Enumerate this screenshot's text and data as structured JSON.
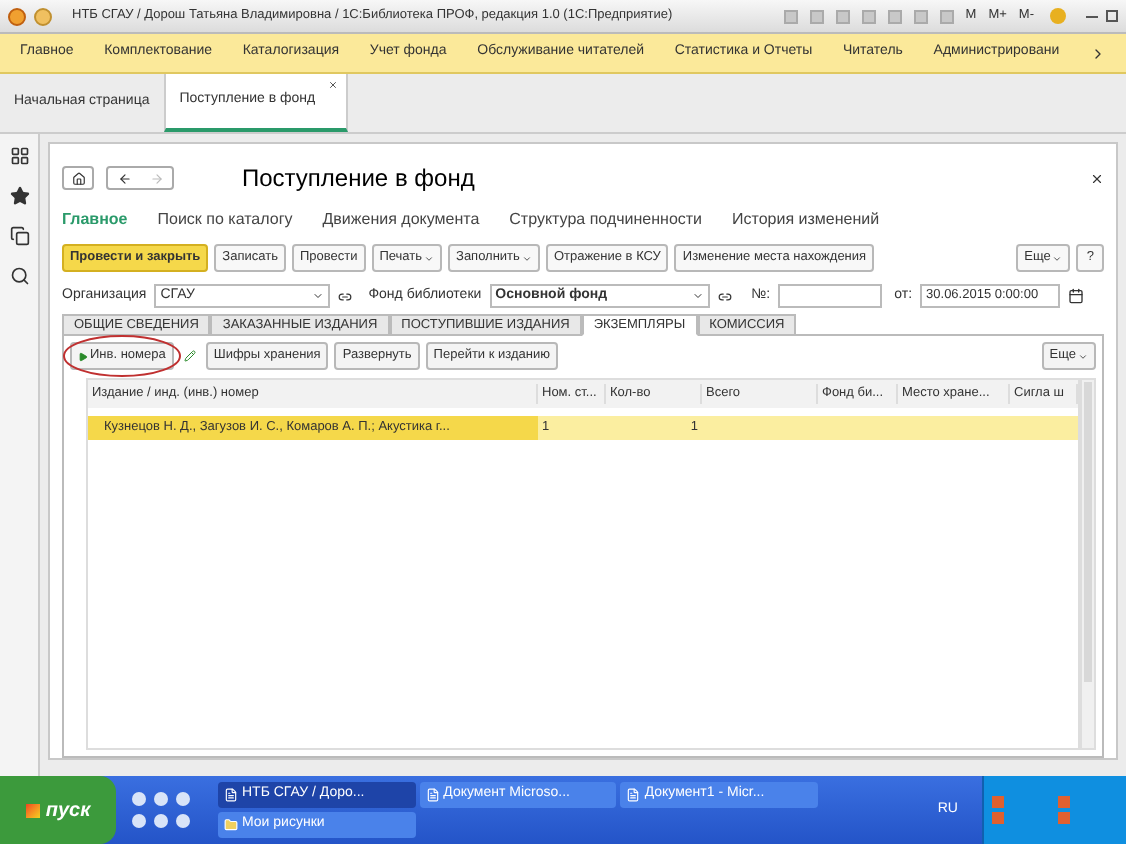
{
  "window": {
    "title": "НТБ СГАУ / Дорош Татьяна Владимировна / 1С:Библиотека ПРОФ, редакция 1.0  (1С:Предприятие)",
    "memory_buttons": [
      "M",
      "M+",
      "M-"
    ]
  },
  "menu": [
    "Главное",
    "Комплектование",
    "Каталогизация",
    "Учет фонда",
    "Обслуживание читателей",
    "Статистика и Отчеты",
    "Читатель",
    "Администрировани"
  ],
  "open_tabs": [
    {
      "label": "Начальная страница",
      "selected": false
    },
    {
      "label": "Поступление в фонд",
      "selected": true
    }
  ],
  "form": {
    "title": "Поступление в фонд",
    "nav": [
      {
        "label": "Главное",
        "selected": true
      },
      {
        "label": "Поиск по каталогу",
        "selected": false
      },
      {
        "label": "Движения документа",
        "selected": false
      },
      {
        "label": "Структура подчиненности",
        "selected": false
      },
      {
        "label": "История изменений",
        "selected": false
      }
    ],
    "toolbar": [
      {
        "label": "Провести и закрыть",
        "kind": "primary"
      },
      {
        "label": "Записать",
        "kind": "plain"
      },
      {
        "label": "Провести",
        "kind": "plain"
      },
      {
        "label": "Печать",
        "kind": "dropdown"
      },
      {
        "label": "Заполнить",
        "kind": "dropdown"
      },
      {
        "label": "Отражение в КСУ",
        "kind": "plain"
      },
      {
        "label": "Изменение места нахождения",
        "kind": "plain"
      }
    ],
    "more": "Еще",
    "help": "?",
    "organization": {
      "label": "Организация",
      "value": "СГАУ"
    },
    "fund": {
      "label": "Фонд библиотеки",
      "value": "Основной фонд"
    },
    "number": {
      "label": "№:"
    },
    "date": {
      "label": "от:",
      "value": "30.06.2015  0:00:00"
    },
    "tabs": [
      {
        "label": "ОБЩИЕ СВЕДЕНИЯ",
        "selected": false
      },
      {
        "label": "ЗАКАЗАННЫЕ ИЗДАНИЯ",
        "selected": false
      },
      {
        "label": "ПОСТУПИВШИЕ ИЗДАНИЯ",
        "selected": false
      },
      {
        "label": "ЭКЗЕМПЛЯРЫ",
        "selected": true
      },
      {
        "label": "КОМИССИЯ",
        "selected": false
      }
    ],
    "table_toolbar": {
      "buttons": [
        "Инв. номера",
        "Шифры хранения",
        "Развернуть",
        "Перейти к изданию"
      ],
      "more": "Еще"
    },
    "table": {
      "columns": [
        "Издание / инд. (инв.) номер",
        "Ном. ст...",
        "Кол-во",
        "Всего",
        "Фонд би...",
        "Место хране...",
        "Сигла ш"
      ],
      "rows": [
        {
          "cells": [
            "Кузнецов Н. Д., Загузов И. С., Комаров А. П.; Акустика г...",
            "1",
            "1"
          ],
          "selected": true
        }
      ]
    }
  },
  "taskbar": {
    "start": "пуск",
    "tasks": [
      {
        "label": "НТБ СГАУ / Доро...",
        "selected": true
      },
      {
        "label": "Документ Microso...",
        "selected": false
      },
      {
        "label": "Документ1 - Micr...",
        "selected": false
      },
      {
        "label": "Мои рисунки",
        "selected": false
      }
    ],
    "language": "RU"
  }
}
